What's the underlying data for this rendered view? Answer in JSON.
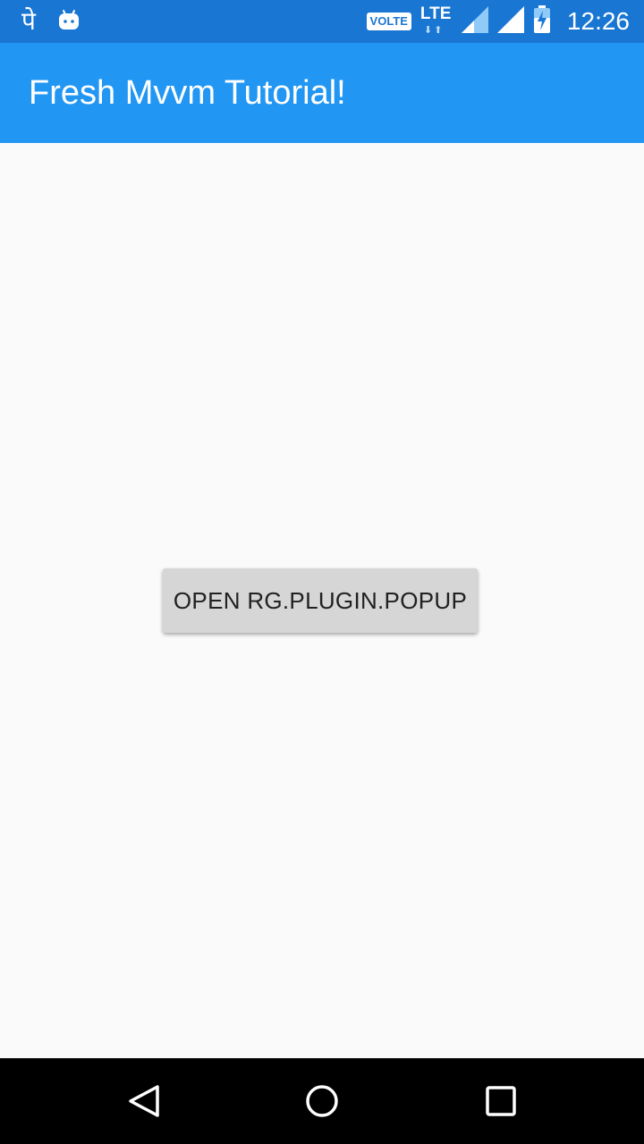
{
  "status_bar": {
    "left_icons": [
      "phonepe-icon",
      "android-icon"
    ],
    "phonepe_glyph": "पे",
    "volte_label": "VOLTE",
    "lte_label": "LTE",
    "time": "12:26"
  },
  "app_bar": {
    "title": "Fresh Mvvm Tutorial!",
    "color": "#2196f3"
  },
  "main": {
    "button_label": "OPEN RG.PLUGIN.POPUP"
  },
  "nav_bar": {
    "buttons": [
      "back-icon",
      "home-icon",
      "recents-icon"
    ]
  }
}
